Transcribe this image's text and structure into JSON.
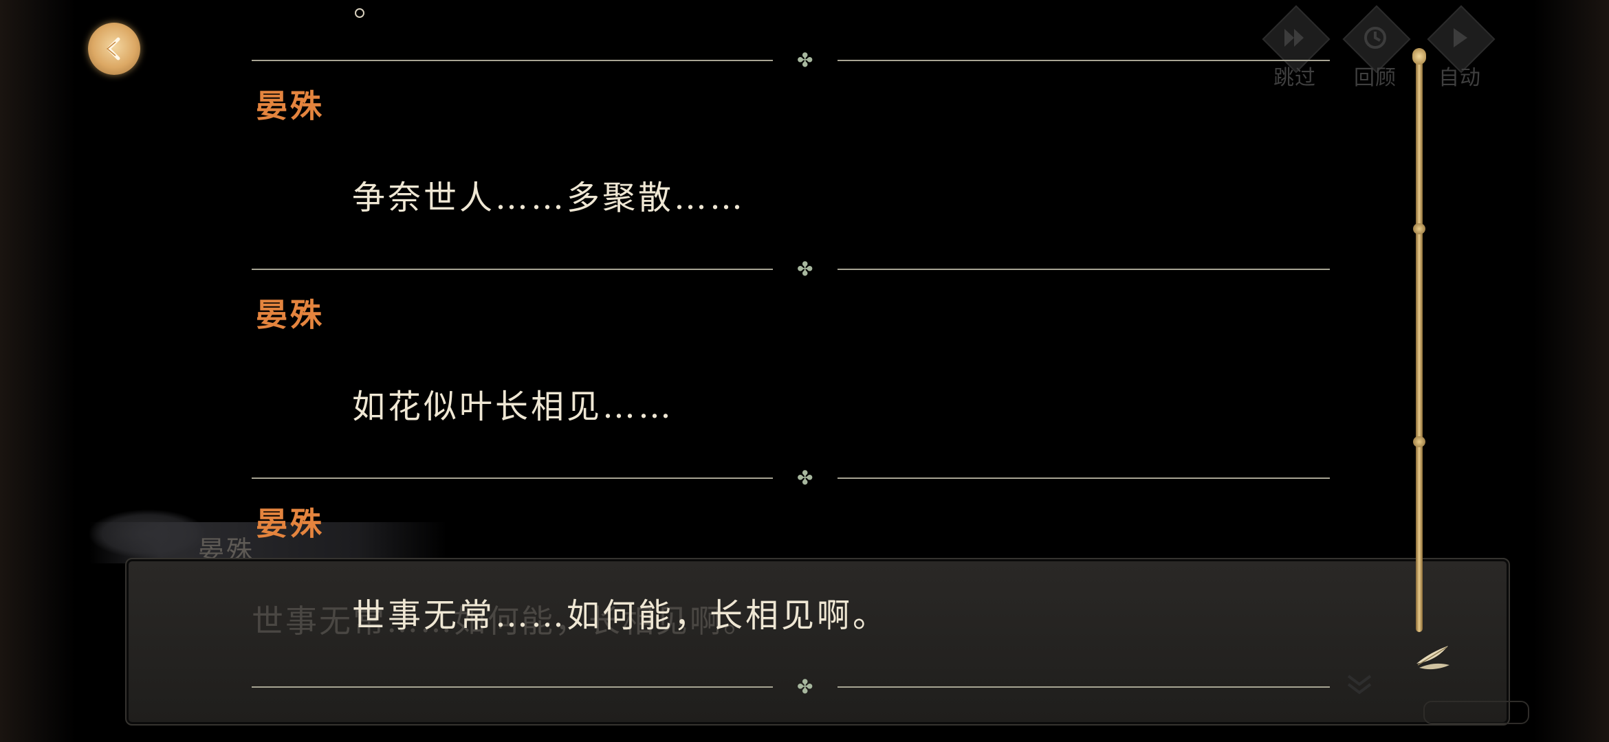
{
  "background": {
    "speaker_name": "晏殊",
    "dialog_text": "世事无常……如何能，长相见啊。"
  },
  "controls": {
    "skip_label": "跳过",
    "review_label": "回顾",
    "auto_label": "自动"
  },
  "history": {
    "entries": [
      {
        "speaker": "晏殊",
        "text": "争奈世人……多聚散……"
      },
      {
        "speaker": "晏殊",
        "text": "如花似叶长相见……"
      },
      {
        "speaker": "晏殊",
        "text": "世事无常……如何能，长相见啊。"
      }
    ],
    "separator_icon": "clover-icon",
    "accent_color": "#e4843e"
  }
}
